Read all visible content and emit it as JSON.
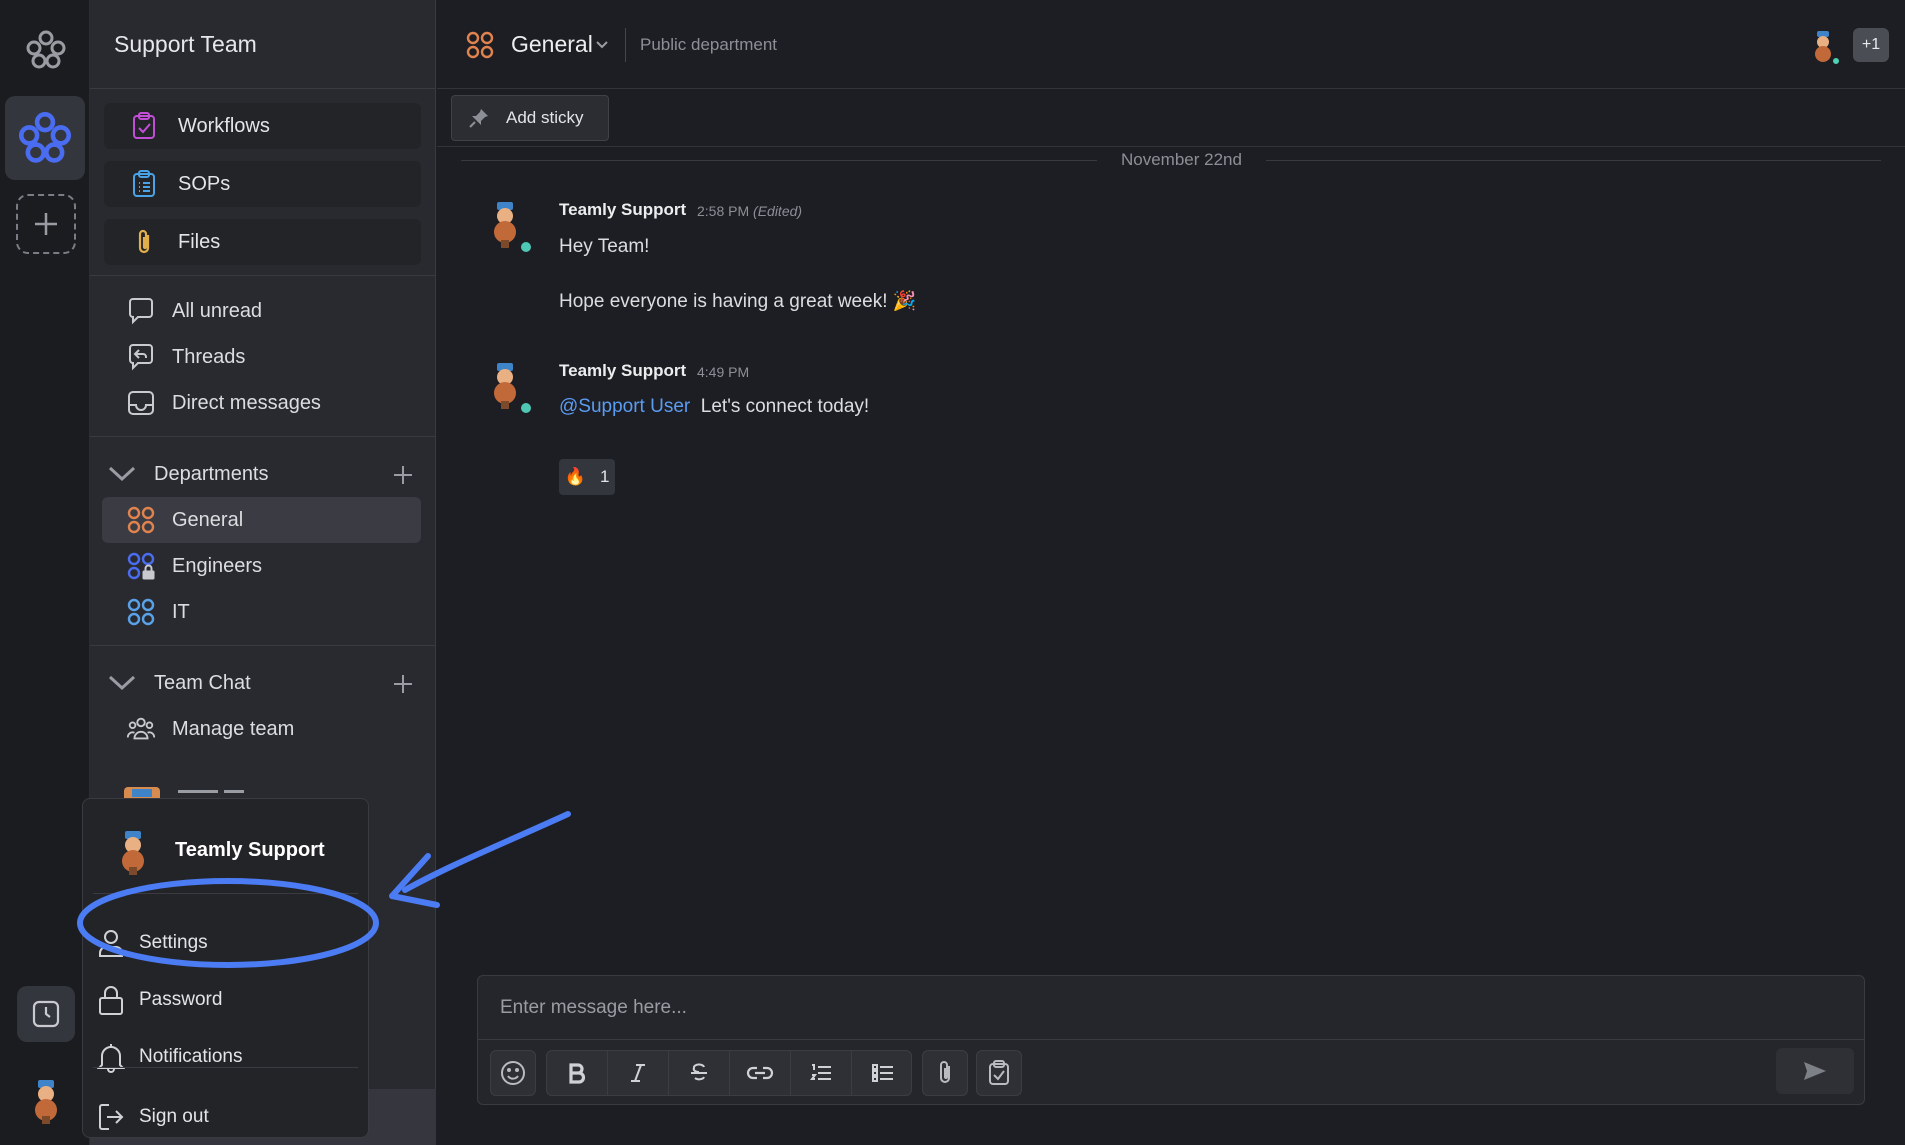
{
  "workspace": {
    "title": "Support Team"
  },
  "sidebar": {
    "tools": [
      {
        "label": "Workflows",
        "icon": "workflows-icon"
      },
      {
        "label": "SOPs",
        "icon": "sops-icon"
      },
      {
        "label": "Files",
        "icon": "paperclip-icon"
      }
    ],
    "nav": [
      {
        "label": "All unread",
        "icon": "chat-bubble-icon"
      },
      {
        "label": "Threads",
        "icon": "threads-icon"
      },
      {
        "label": "Direct messages",
        "icon": "inbox-icon"
      }
    ],
    "departments": {
      "title": "Departments",
      "items": [
        {
          "label": "General",
          "color": "#e0834e",
          "active": true
        },
        {
          "label": "Engineers",
          "color": "#4a6cf0",
          "locked": true
        },
        {
          "label": "IT",
          "color": "#5aa2e8"
        }
      ]
    },
    "team_chat": {
      "title": "Team Chat",
      "items": [
        {
          "label": "Manage team",
          "icon": "team-icon"
        }
      ]
    }
  },
  "channel": {
    "name": "General",
    "type": "Public department",
    "member_count": "+1"
  },
  "toolbar": {
    "sticky_label": "Add sticky"
  },
  "messages": {
    "date": "November 22nd",
    "items": [
      {
        "author": "Teamly Support",
        "time": "2:58 PM",
        "edited": "(Edited)",
        "lines": [
          "Hey Team!",
          "Hope everyone is having a great week! 🎉"
        ]
      },
      {
        "author": "Teamly Support",
        "time": "4:49 PM",
        "mention": "@Support User",
        "text": "Let's connect today!",
        "reaction": {
          "emoji": "🔥",
          "count": "1"
        }
      }
    ]
  },
  "composer": {
    "placeholder": "Enter message here..."
  },
  "profile_menu": {
    "user": "Teamly Support",
    "items": [
      {
        "label": "Settings",
        "icon": "user-icon"
      },
      {
        "label": "Password",
        "icon": "lock-icon"
      },
      {
        "label": "Notifications",
        "icon": "bell-icon"
      },
      {
        "label": "Sign out",
        "icon": "sign-out-icon"
      }
    ]
  },
  "colors": {
    "accent": "#4a6cf0",
    "link": "#5b9cf3",
    "online": "#4fc7b5",
    "annotation": "#4b7cf3"
  }
}
